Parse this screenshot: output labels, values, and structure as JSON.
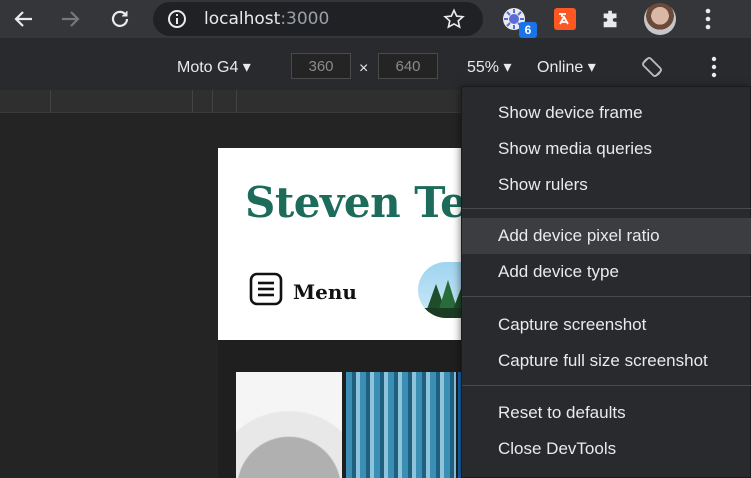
{
  "browser": {
    "url_host": "localhost",
    "url_port": ":3000",
    "extension_badge": "6",
    "icons": [
      "back-icon",
      "forward-icon",
      "reload-icon",
      "info-icon",
      "star-icon",
      "extension-icon",
      "puzzle-icon",
      "kebab-menu-icon"
    ]
  },
  "device_toolbar": {
    "device": "Moto G4",
    "width": "360",
    "times": "×",
    "height": "640",
    "zoom": "55%",
    "throttle": "Online"
  },
  "page": {
    "site_title": "Steven Ter",
    "menu_label": "Menu"
  },
  "context_menu": {
    "items": [
      {
        "label": "Show device frame"
      },
      {
        "label": "Show media queries"
      },
      {
        "label": "Show rulers"
      },
      {
        "label": "Add device pixel ratio"
      },
      {
        "label": "Add device type"
      },
      {
        "label": "Capture screenshot"
      },
      {
        "label": "Capture full size screenshot"
      },
      {
        "label": "Reset to defaults"
      },
      {
        "label": "Close DevTools"
      }
    ],
    "hovered_item": "Add device pixel ratio"
  },
  "colors": {
    "title_green": "#1d6b5a",
    "badge_blue": "#1a73e8",
    "menu_bg": "#292a2d"
  }
}
